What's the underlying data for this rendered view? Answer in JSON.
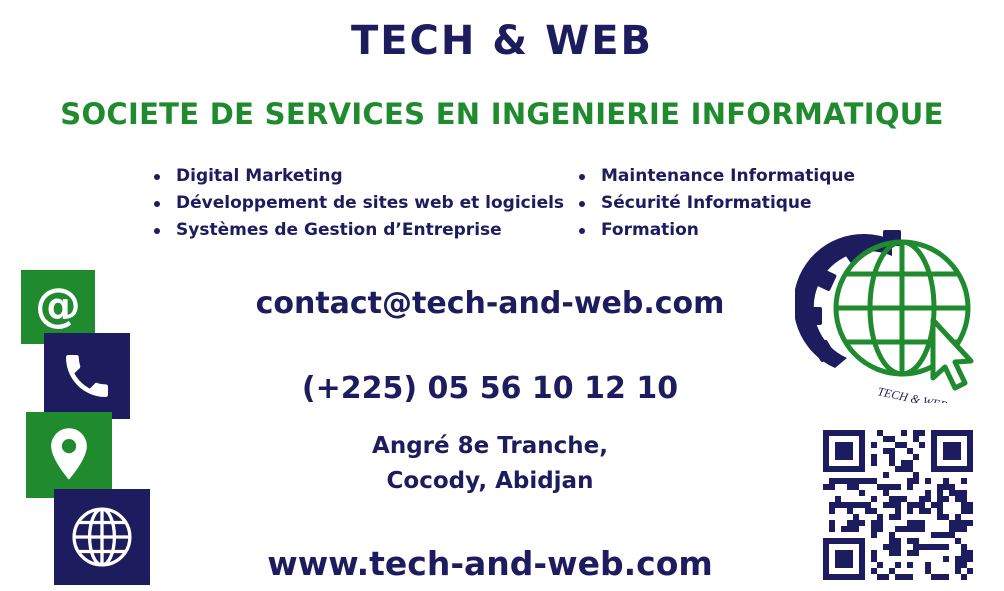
{
  "header": {
    "title": "TECH & WEB",
    "subtitle": "SOCIETE DE SERVICES EN INGENIERIE INFORMATIQUE"
  },
  "services": {
    "left": [
      "Digital Marketing",
      "Développement de sites web et logiciels",
      "Systèmes de Gestion d’Entreprise"
    ],
    "right": [
      "Maintenance Informatique",
      "Sécurité Informatique",
      "Formation"
    ]
  },
  "contact": {
    "email": "contact@tech-and-web.com",
    "phone": "(+225) 05 56 10 12 10",
    "address_line1": "Angré 8e Tranche,",
    "address_line2": "Cocody, Abidjan",
    "website": "www.tech-and-web.com"
  },
  "icons": {
    "email": "at-icon",
    "phone": "phone-icon",
    "location": "location-pin-icon",
    "web": "globe-icon",
    "logo": "gear-globe-cursor-logo",
    "qr": "qr-code"
  },
  "logo": {
    "text": "TECH & WEB"
  },
  "colors": {
    "navy": "#1c1c5e",
    "green": "#1f8a2e",
    "background": "#ffffff"
  }
}
